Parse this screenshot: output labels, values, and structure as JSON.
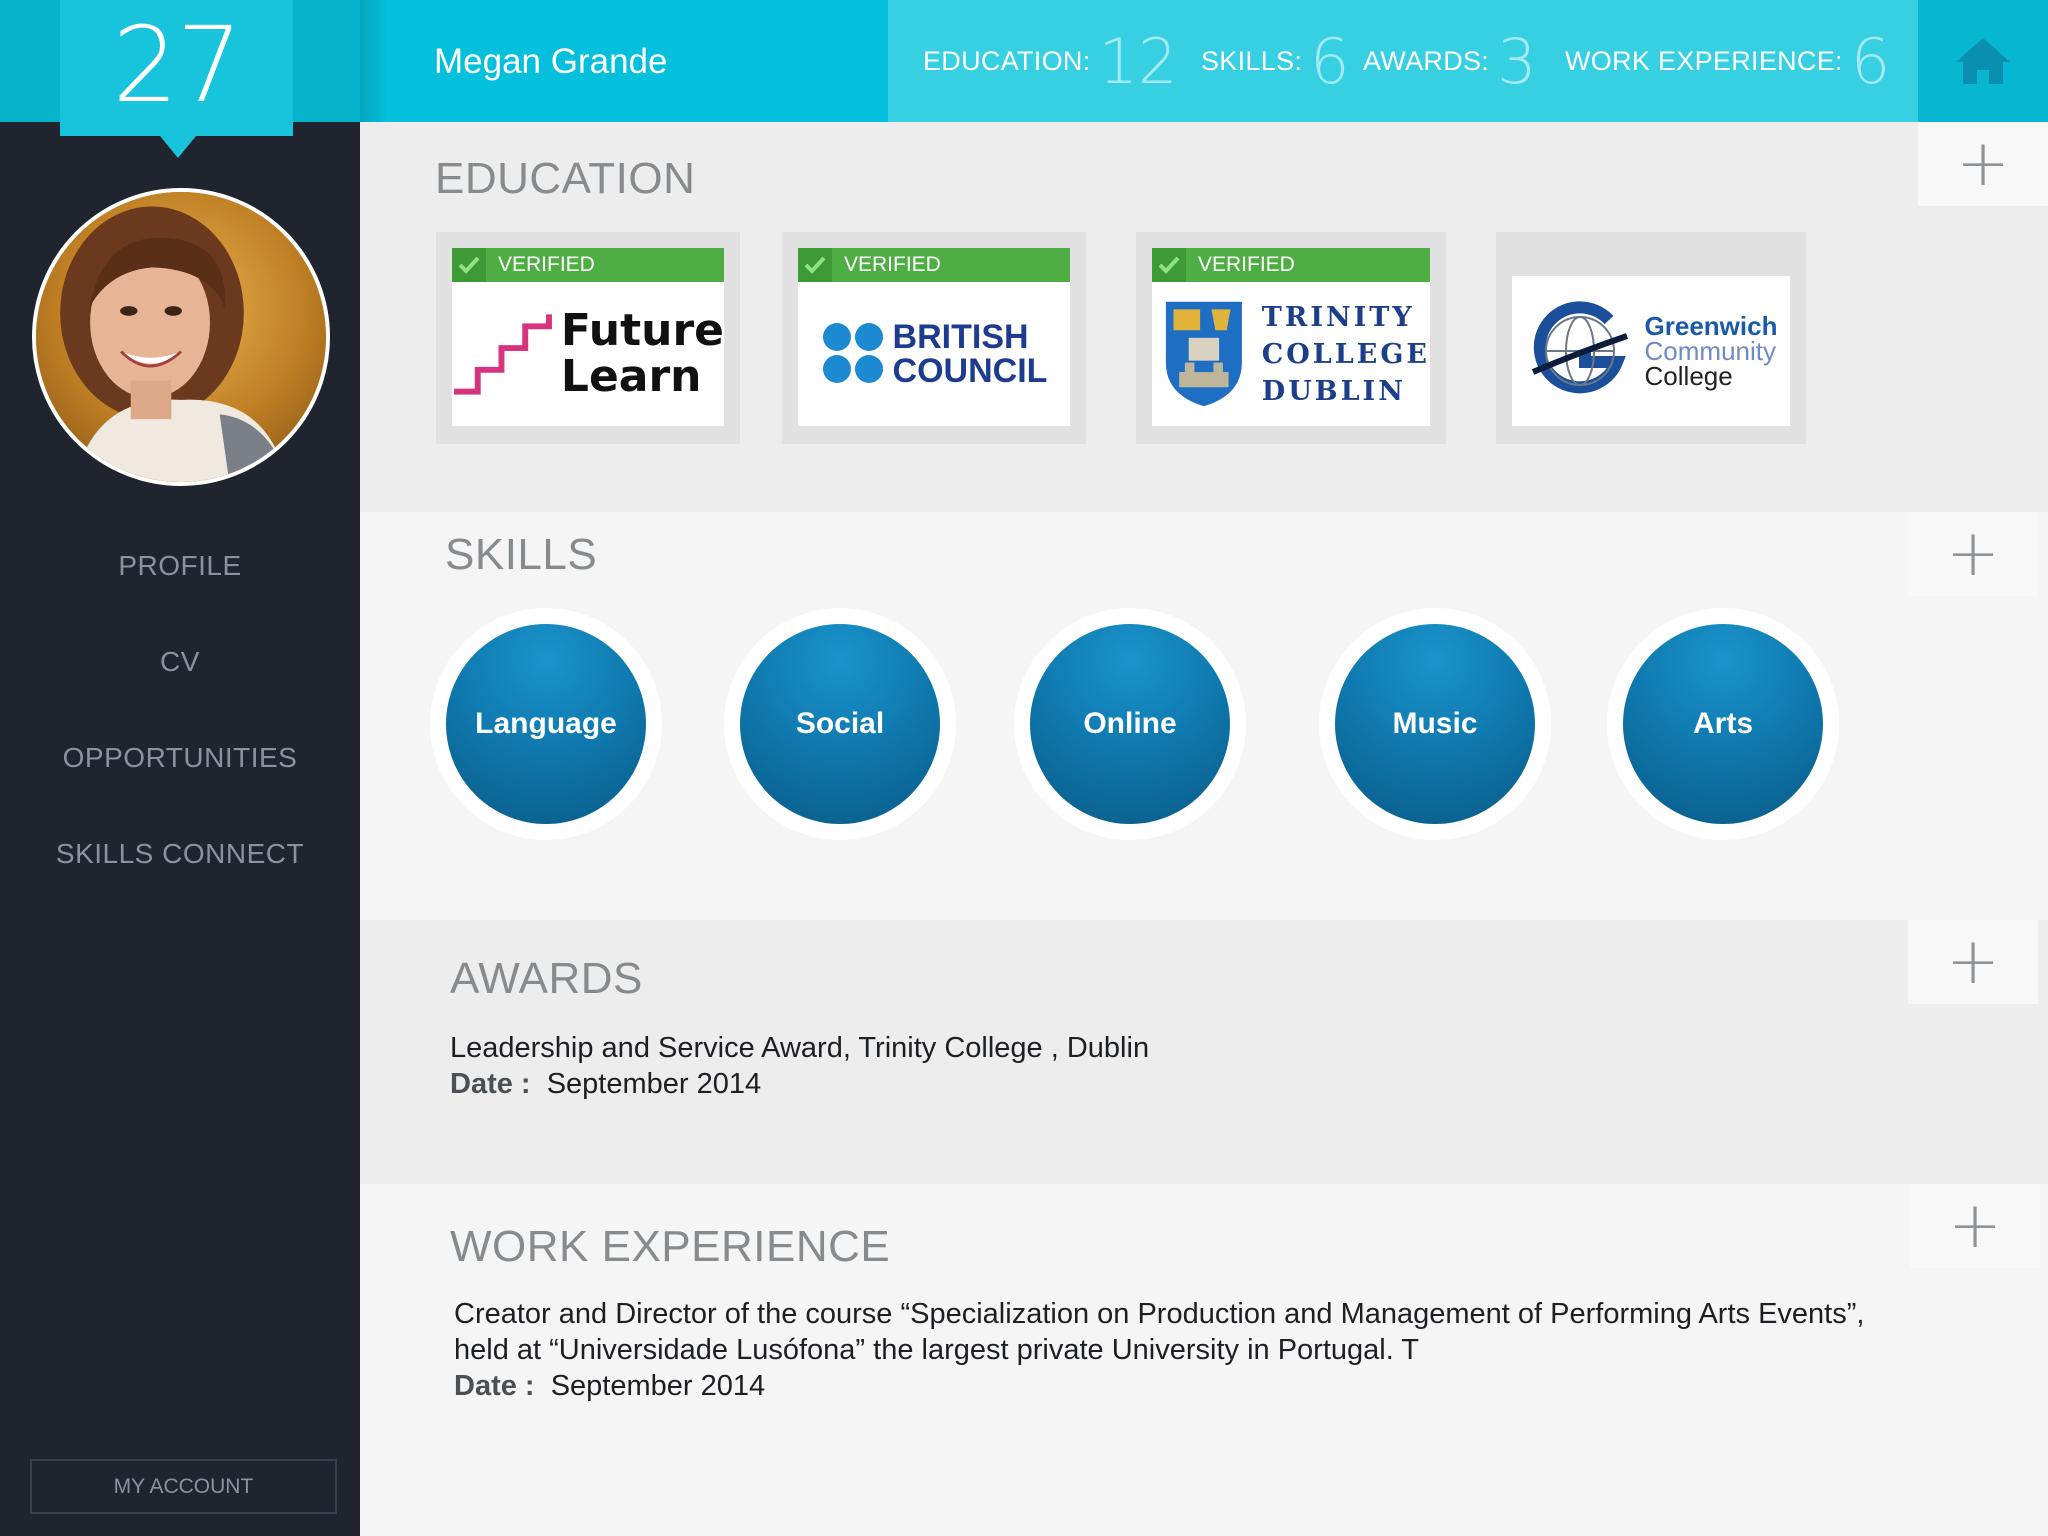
{
  "sidebar": {
    "badge_count": "27",
    "nav": [
      {
        "label": "PROFILE"
      },
      {
        "label": "CV"
      },
      {
        "label": "OPPORTUNITIES"
      },
      {
        "label": "SKILLS CONNECT"
      }
    ],
    "account_label": "MY ACCOUNT"
  },
  "header": {
    "user_name": "Megan Grande",
    "stats": [
      {
        "label": "EDUCATION:",
        "count": "12"
      },
      {
        "label": "SKILLS:",
        "count": "6"
      },
      {
        "label": "AWARDS:",
        "count": "3"
      },
      {
        "label": "WORK EXPERIENCE:",
        "count": "6"
      }
    ]
  },
  "education": {
    "title": "EDUCATION",
    "items": [
      {
        "verified_label": "VERIFIED",
        "logo_lines": [
          "Future",
          "Learn"
        ]
      },
      {
        "verified_label": "VERIFIED",
        "logo_lines": [
          "BRITISH",
          "COUNCIL"
        ]
      },
      {
        "verified_label": "VERIFIED",
        "logo_lines": [
          "TRINITY",
          "COLLEGE",
          "DUBLIN"
        ]
      },
      {
        "logo_lines": [
          "Greenwich",
          "Community",
          "College"
        ]
      }
    ]
  },
  "skills": {
    "title": "SKILLS",
    "items": [
      "Language",
      "Social",
      "Online",
      "Music",
      "Arts"
    ]
  },
  "awards": {
    "title": "AWARDS",
    "entry": {
      "description": "Leadership and Service Award, Trinity College , Dublin",
      "date_label": "Date :",
      "date_value": "September 2014"
    }
  },
  "work_experience": {
    "title": "WORK EXPERIENCE",
    "entry": {
      "description_line1": "Creator and Director of the course “Specialization on Production and Management of Performing Arts Events”,",
      "description_line2": "held at “Universidade Lusófona” the largest private University in Portugal. T",
      "date_label": "Date :",
      "date_value": "September 2014"
    }
  },
  "add_symbol": "+",
  "colors": {
    "header": "#05c0dc",
    "header_stats": "#36d0e2",
    "sidebar": "#1f242e",
    "verified": "#4fae43",
    "skill_bubble": "#0f7ab0"
  }
}
